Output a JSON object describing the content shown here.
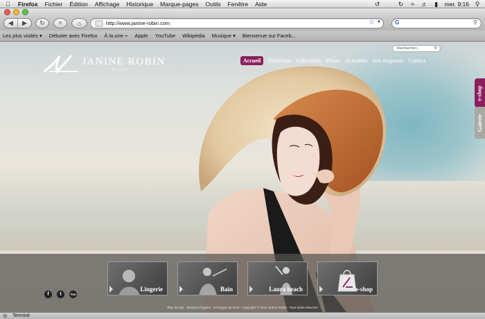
{
  "menubar": {
    "items": [
      "Firefox",
      "Fichier",
      "Édition",
      "Affichage",
      "Historique",
      "Marque-pages",
      "Outils",
      "Fenêtre",
      "Aide"
    ],
    "clock": "mer. 9:16"
  },
  "toolbar": {
    "url": "http://www.janine-robin.com"
  },
  "bookmarks": [
    "Les plus visités ▾",
    "Débuter avec Firefox",
    "À la une ⌁",
    "Apple",
    "YouTube",
    "Wikipédia",
    "Musique ▾",
    "Bienvenue sur Faceb..."
  ],
  "site": {
    "logo": "JANINE ROBIN",
    "logo_sub": "PARIS",
    "search_placeholder": "Rechercher...",
    "nav": [
      "Accueil",
      "Historique",
      "Collections",
      "Presse",
      "Actualités",
      "Nos magasins",
      "Contact"
    ],
    "side_tabs": [
      "e-shop",
      "Galerie"
    ],
    "cards": [
      "Lingerie",
      "Bain",
      "Laura beach",
      "e-shop"
    ],
    "social": [
      "f",
      "t",
      "You"
    ],
    "footer_text": "Plan du site - Mentions légales - Echanges de liens - Copyright © 2010 Janine Robin - Tous droits réservés"
  },
  "status": {
    "text": "Terminé"
  }
}
